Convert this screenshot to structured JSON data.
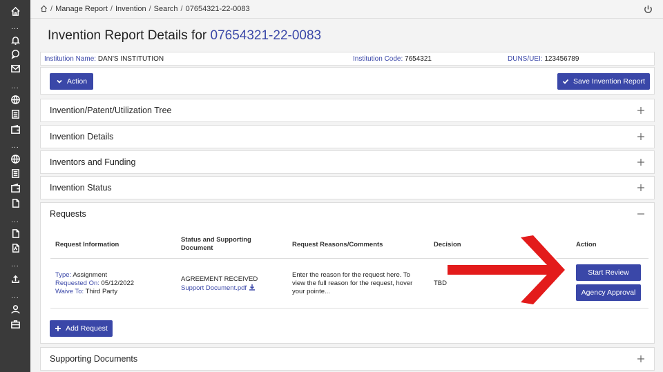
{
  "rail": {
    "icons": [
      "home-icon",
      "bell-icon",
      "chat-search-icon",
      "mail-icon",
      "globe-icon",
      "document-list-icon",
      "wallet-icon",
      "globe-icon",
      "document-list-icon",
      "wallet-icon",
      "file-icon",
      "file-icon",
      "pdf-file-icon",
      "upload-icon",
      "user-icon",
      "briefcase-icon"
    ],
    "dots": "..."
  },
  "breadcrumb": {
    "items": [
      "Manage Report",
      "Invention",
      "Search",
      "07654321-22-0083"
    ],
    "separator": "/"
  },
  "page": {
    "title_prefix": "Invention Report Details for",
    "title_number": "07654321-22-0083"
  },
  "info": {
    "institution_name_label": "Institution Name:",
    "institution_name": "DAN'S INSTITUTION",
    "institution_code_label": "Institution Code:",
    "institution_code": "7654321",
    "duns_label": "DUNS/UEI:",
    "duns": "123456789"
  },
  "actions": {
    "action_label": "Action",
    "save_label": "Save Invention Report"
  },
  "panels": [
    {
      "title": "Invention/Patent/Utilization Tree"
    },
    {
      "title": "Invention Details"
    },
    {
      "title": "Inventors and Funding"
    },
    {
      "title": "Invention Status"
    }
  ],
  "requests": {
    "title": "Requests",
    "headers": {
      "info": "Request Information",
      "status_line1": "Status and Supporting",
      "status_line2": "Document",
      "reasons": "Request Reasons/Comments",
      "decision": "Decision",
      "action": "Action"
    },
    "row": {
      "type_label": "Type:",
      "type": "Assignment",
      "requested_on_label": "Requested On:",
      "requested_on": "05/12/2022",
      "waive_to_label": "Waive To:",
      "waive_to": "Third Party",
      "status": "AGREEMENT RECEIVED",
      "document": "Support Document.pdf",
      "reason_line1": "Enter the reason for the request here. To",
      "reason_line2": "view the full reason for the request, hover",
      "reason_line3": "your pointe...",
      "decision": "TBD",
      "start_review": "Start Review",
      "agency_approval": "Agency Approval"
    },
    "add_request": "Add Request"
  },
  "supporting_documents": {
    "title": "Supporting Documents"
  },
  "colors": {
    "accent": "#3a47a8",
    "rail": "#3a3a3a",
    "annotation_arrow": "#e31b1b"
  }
}
